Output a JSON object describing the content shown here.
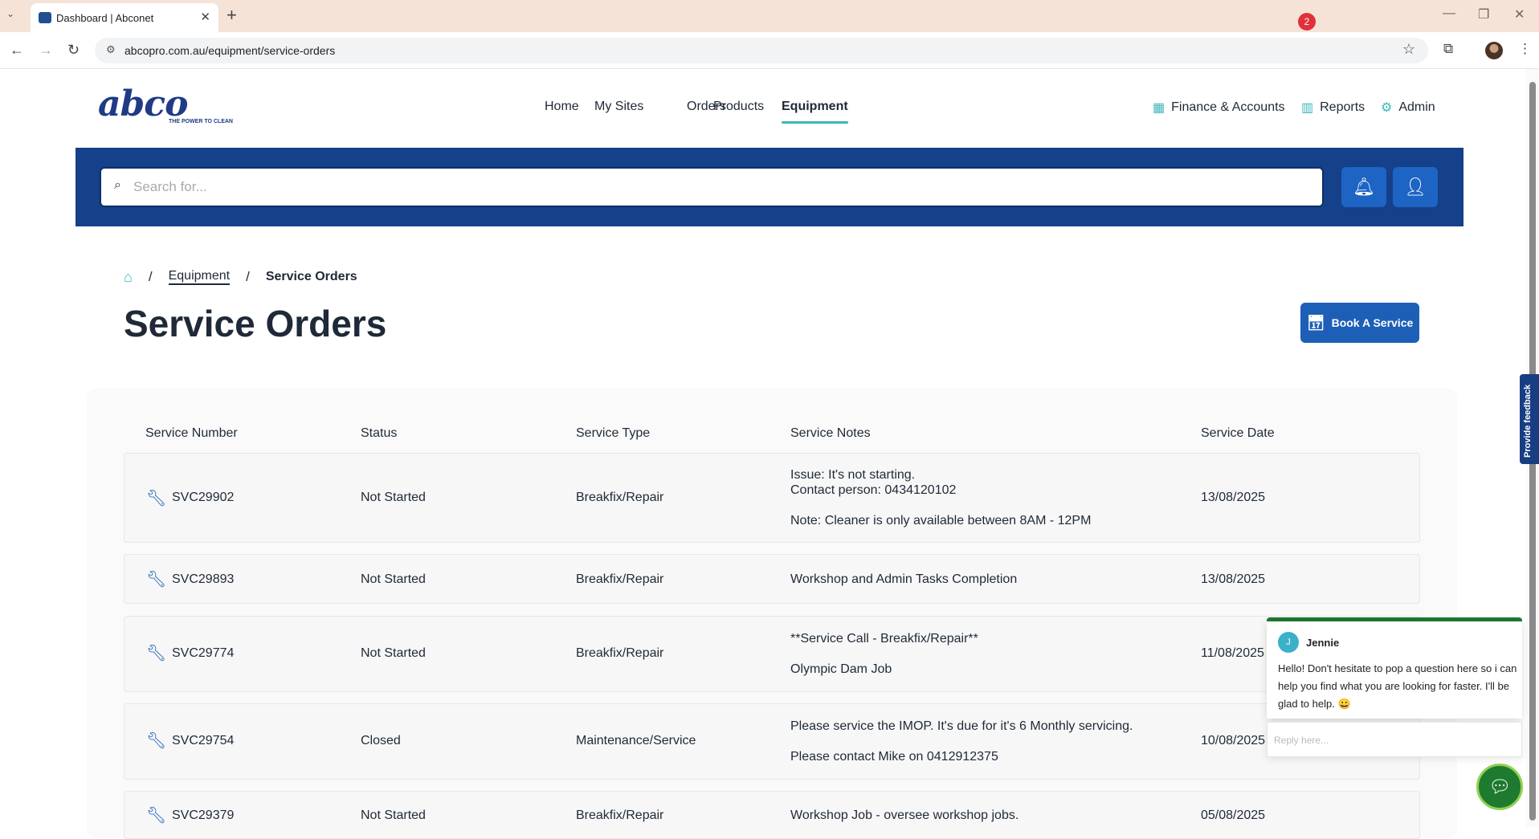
{
  "browser": {
    "tab_title": "Dashboard | Abconet",
    "url": "abcopro.com.au/equipment/service-orders"
  },
  "header": {
    "logo_text": "abco",
    "logo_tagline": "THE POWER TO CLEAN",
    "nav": [
      "Home",
      "My Sites",
      "Orders",
      "Products",
      "Equipment"
    ],
    "active_nav": "Equipment",
    "right_nav": [
      "Finance & Accounts",
      "Reports",
      "Admin"
    ]
  },
  "search": {
    "placeholder": "Search for..."
  },
  "notifications": {
    "count": "2"
  },
  "breadcrumb": {
    "items": [
      "Equipment",
      "Service Orders"
    ]
  },
  "page": {
    "title": "Service Orders",
    "book_button": "Book A Service"
  },
  "table": {
    "headers": [
      "Service Number",
      "Status",
      "Service Type",
      "Service Notes",
      "Service Date"
    ],
    "rows": [
      {
        "number": "SVC29902",
        "status": "Not Started",
        "type": "Breakfix/Repair",
        "notes": [
          "Issue: It's not starting.",
          "Contact person: 0434120102",
          "",
          "Note: Cleaner is only available between 8AM - 12PM"
        ],
        "date": "13/08/2025"
      },
      {
        "number": "SVC29893",
        "status": "Not Started",
        "type": "Breakfix/Repair",
        "notes": [
          "Workshop and Admin Tasks Completion"
        ],
        "date": "13/08/2025"
      },
      {
        "number": "SVC29774",
        "status": "Not Started",
        "type": "Breakfix/Repair",
        "notes": [
          "**Service Call - Breakfix/Repair**",
          "",
          "Olympic Dam Job"
        ],
        "date": "11/08/2025"
      },
      {
        "number": "SVC29754",
        "status": "Closed",
        "type": "Maintenance/Service",
        "notes": [
          "Please service the IMOP. It's due for it's 6 Monthly servicing.",
          "",
          "Please contact Mike on 0412912375"
        ],
        "date": "10/08/2025"
      },
      {
        "number": "SVC29379",
        "status": "Not Started",
        "type": "Breakfix/Repair",
        "notes": [
          "Workshop Job - oversee workshop jobs."
        ],
        "date": "05/08/2025"
      }
    ]
  },
  "feedback_tab": "Provide feedback",
  "chat": {
    "agent_initial": "J",
    "agent_name": "Jennie",
    "message": "Hello!  Don't hesitate to pop a question here so i can help you find what you are looking for faster. I'll be glad to help. 😀",
    "reply_placeholder": "Reply here..."
  },
  "colors": {
    "brand_blue": "#15408a",
    "button_blue": "#1d5fb7",
    "accent_teal": "#3ab8b8",
    "badge_red": "#e0303b",
    "chat_green": "#1e7a2e"
  }
}
